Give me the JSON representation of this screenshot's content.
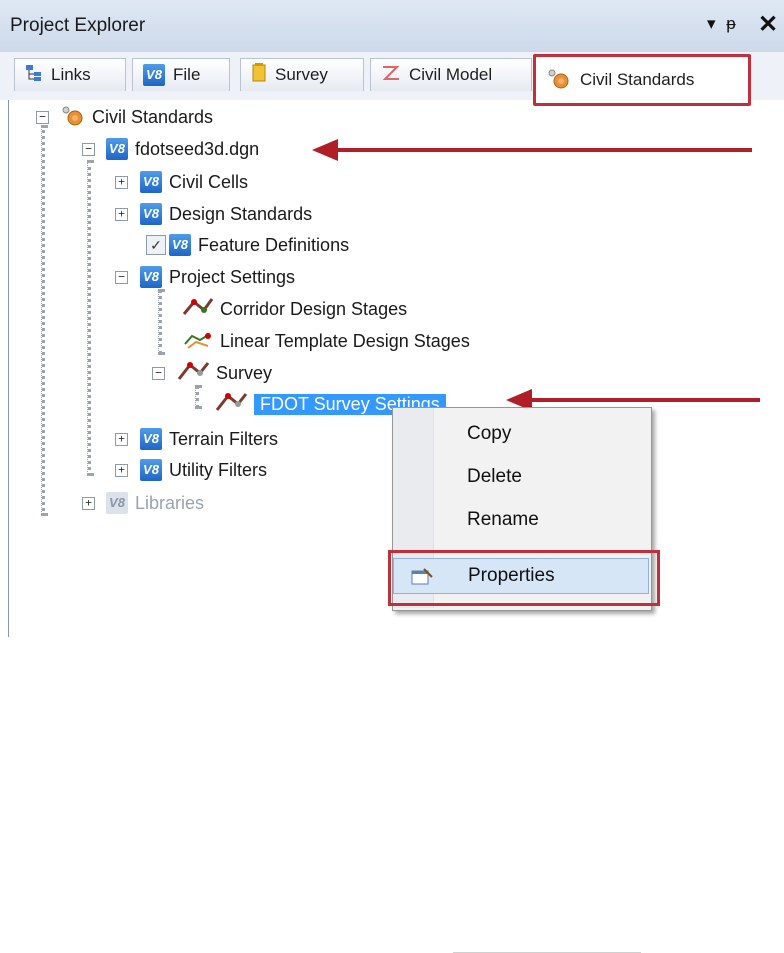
{
  "panel": {
    "title": "Project Explorer",
    "pin_glyph": "▾ ᵽ",
    "close_glyph": "✕"
  },
  "tabs": [
    {
      "label": "Links",
      "icon": "links-icon"
    },
    {
      "label": "File",
      "icon": "v8-file-icon"
    },
    {
      "label": "Survey",
      "icon": "survey-icon"
    },
    {
      "label": "Civil Model",
      "icon": "civil-model-icon"
    },
    {
      "label": "Civil Standards",
      "icon": "civil-standards-icon",
      "active": true
    }
  ],
  "tree": {
    "root": "Civil Standards",
    "file": "fdotseed3d.dgn",
    "civil_cells": "Civil Cells",
    "design_standards": "Design Standards",
    "feature_definitions": "Feature Definitions",
    "project_settings": "Project Settings",
    "corridor_design_stages": "Corridor Design Stages",
    "linear_template_design_stages": "Linear Template Design Stages",
    "survey": "Survey",
    "fdot_survey_settings": "FDOT Survey Settings",
    "terrain_filters": "Terrain Filters",
    "utility_filters": "Utility Filters",
    "libraries": "Libraries"
  },
  "context_menu": {
    "copy": "Copy",
    "delete": "Delete",
    "rename": "Rename",
    "properties": "Properties"
  },
  "icon_text": {
    "v8": "V8",
    "plus": "+",
    "minus": "−",
    "check": "✓"
  },
  "colors": {
    "highlight_red": "#c0303a",
    "selection_blue": "#3399ff",
    "annotation_arrow": "#b01e28"
  }
}
